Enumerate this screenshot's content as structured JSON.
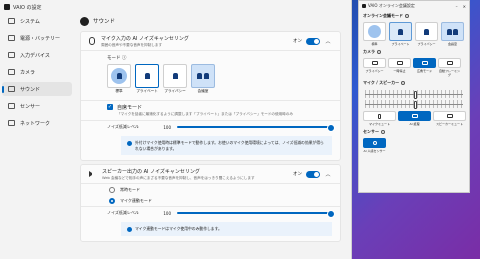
{
  "main_window": {
    "title": "VAIO の設定",
    "sidebar": [
      {
        "label": "システム",
        "icon": "monitor-icon",
        "active": false
      },
      {
        "label": "電源・バッテリー",
        "icon": "battery-icon",
        "active": false
      },
      {
        "label": "入力デバイス",
        "icon": "keyboard-icon",
        "active": false
      },
      {
        "label": "カメラ",
        "icon": "camera-icon",
        "active": false
      },
      {
        "label": "サウンド",
        "icon": "speaker-icon",
        "active": true
      },
      {
        "label": "センサー",
        "icon": "sensor-icon",
        "active": false
      },
      {
        "label": "ネットワーク",
        "icon": "network-icon",
        "active": false
      }
    ],
    "page_title": "サウンド",
    "mic_card": {
      "title": "マイク入力の AI ノイズキャンセリング",
      "subtitle": "周囲の音声や不要な音声を抑制します",
      "toggle_label": "オン",
      "mode_label": "モード ⓘ",
      "modes": [
        {
          "label": "標準",
          "selected": false
        },
        {
          "label": "プライベート",
          "selected": true
        },
        {
          "label": "プライバシー",
          "selected": false
        },
        {
          "label": "会議室",
          "selected": false
        }
      ],
      "checkbox_title": "自席モード",
      "checkbox_desc": "「マイクを話者に最適化するように調整します「プライベート」または「プライバシー」モードの使用時のみ",
      "slider_label": "ノイズ低減レベル",
      "slider_value": "100",
      "info": "外付けマイク使用時は標準モードで動作します。お使いのマイク使用環境によっては、ノイズ低減の効果が得られない場合があります。"
    },
    "speaker_card": {
      "title": "スピーカー出力の AI ノイズキャンセリング",
      "subtitle": "Web 会議などで相手の声にまざる不要な音声を抑制し、音声をはっきり聞こえるようにします",
      "toggle_label": "オン",
      "radio_options": [
        {
          "label": "常時モード",
          "selected": false
        },
        {
          "label": "マイク連動モード",
          "selected": true
        }
      ],
      "slider_label": "ノイズ低減レベル",
      "slider_value": "100",
      "info": "マイク連動モードはマイク使用中のみ動作します。"
    }
  },
  "right_panel": {
    "title": "VAIO オンライン会議設定",
    "section_meeting": "オンライン会議モード",
    "meeting_tiles": [
      "標準",
      "プライベート",
      "プライバシー",
      "会議室"
    ],
    "section_camera": "カメラ",
    "camera_buttons": [
      {
        "label": "プライバシー",
        "active": false
      },
      {
        "label": "一時停止",
        "active": false
      },
      {
        "label": "広角モード",
        "active": true
      },
      {
        "label": "自動フレーミング",
        "active": false
      }
    ],
    "section_mic": "マイク / スピーカー",
    "mic_tags": [
      {
        "label": "マイクミュート",
        "active": false
      },
      {
        "label": "AI 処理",
        "active": true
      },
      {
        "label": "スピーカーミュート",
        "active": false
      }
    ],
    "section_sensor": "センサー",
    "sensor_button": {
      "label": "AI 人感センサー",
      "active": true
    }
  }
}
